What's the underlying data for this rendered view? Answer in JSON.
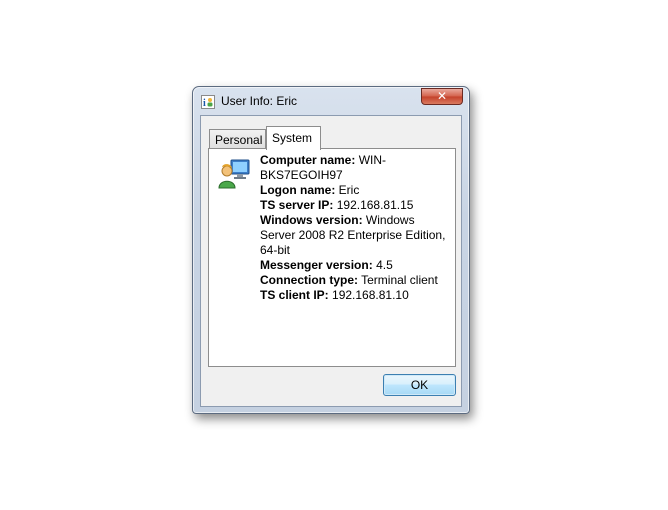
{
  "window": {
    "title": "User Info: Eric",
    "close_glyph": "✕"
  },
  "tabs": [
    {
      "label": "Personal",
      "selected": false
    },
    {
      "label": "System",
      "selected": true
    }
  ],
  "info": [
    {
      "label": "Computer name:",
      "value": "WIN-BKS7EGOIH97"
    },
    {
      "label": "Logon name:",
      "value": "Eric"
    },
    {
      "label": "TS server IP:",
      "value": "192.168.81.15"
    },
    {
      "label": "Windows version:",
      "value": "Windows Server 2008 R2 Enterprise Edition, 64-bit"
    },
    {
      "label": "Messenger version:",
      "value": "4.5"
    },
    {
      "label": "Connection type:",
      "value": "Terminal client"
    },
    {
      "label": "TS client IP:",
      "value": "192.168.81.10"
    }
  ],
  "buttons": {
    "ok": "OK"
  },
  "icons": {
    "app": "user-info-icon",
    "user": "user-computer-icon",
    "close": "close-icon"
  }
}
